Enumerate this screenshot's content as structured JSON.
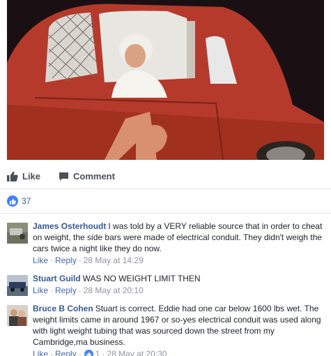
{
  "photo": {
    "subject": "driver in red race car",
    "colors": {
      "body": "#b53a2b",
      "number": "#d89070",
      "sky": "#1a1013"
    }
  },
  "actions": {
    "like_label": "Like",
    "comment_label": "Comment"
  },
  "reactions": {
    "count": "37",
    "icon": "like-icon",
    "color": "#4080ff"
  },
  "comments": [
    {
      "author": "James Osterhoudt",
      "text": "I was told by a VERY reliable source that in order to cheat on weight, the side bars were made of electrical conduit. They didn't weigh the cars twice a night like they do now.",
      "like": "Like",
      "reply": "Reply",
      "date": "28 May at 14:29"
    },
    {
      "author": "Stuart Guild",
      "text": "WAS NO WEIGHT LIMIT THEN",
      "like": "Like",
      "reply": "Reply",
      "date": "28 May at 20:10"
    },
    {
      "author": "Bruce B Cohen",
      "text": "Stuart is correct. Eddie had one car below 1600 lbs wet. The weight limits came in around 1967 or so-yes electrical conduit was used along with light weight tubing that was sourced down the street from my Cambridge,ma business.",
      "like": "Like",
      "reply": "Reply",
      "like_count": "1",
      "date": "28 May at 20:30"
    }
  ],
  "colors": {
    "link": "#365899",
    "meta": "#90949c",
    "action": "#4b4f56"
  }
}
